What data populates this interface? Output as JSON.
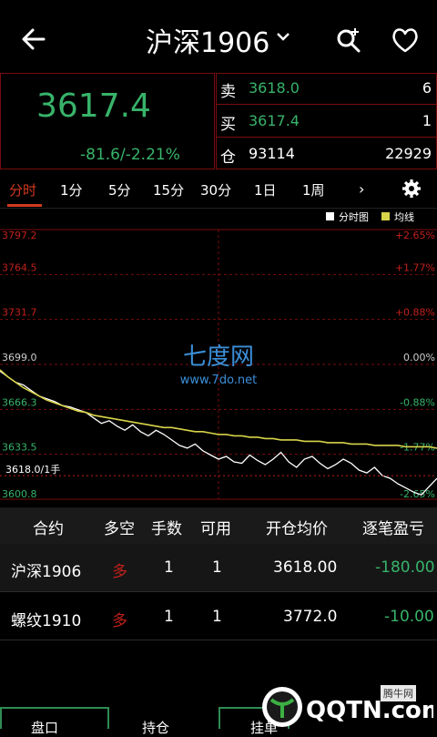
{
  "header": {
    "title": "沪深1906"
  },
  "quote": {
    "last_price": "3617.4",
    "change": "-81.6/-2.21%",
    "rows": [
      {
        "label": "卖",
        "value": "3618.0",
        "volume": "6"
      },
      {
        "label": "买",
        "value": "3617.4",
        "volume": "1"
      },
      {
        "label": "仓",
        "value": "93114",
        "volume": "22929"
      }
    ]
  },
  "tabs": [
    "分时",
    "1分",
    "5分",
    "15分",
    "30分",
    "1日",
    "1周"
  ],
  "tabs_more": "›",
  "chart_data": {
    "type": "line",
    "legend": [
      "分时图",
      "均线"
    ],
    "y_left_ticks": [
      "3797.2",
      "3764.5",
      "3731.7",
      "3699.0",
      "3666.3",
      "3633.5",
      "3600.8"
    ],
    "y_right_ticks": [
      "+2.65%",
      "+1.77%",
      "+0.88%",
      "0.00%",
      "-0.88%",
      "-1.77%",
      "-2.65%"
    ],
    "ylim": [
      3600.8,
      3797.2
    ],
    "annotation": "3618.0/1手",
    "series": [
      {
        "name": "分时图",
        "values": [
          3694,
          3690,
          3686,
          3684,
          3680,
          3676,
          3674,
          3672,
          3669,
          3668,
          3666,
          3664,
          3660,
          3656,
          3658,
          3654,
          3651,
          3655,
          3650,
          3647,
          3651,
          3648,
          3644,
          3640,
          3638,
          3641,
          3636,
          3633,
          3630,
          3632,
          3628,
          3627,
          3633,
          3629,
          3626,
          3630,
          3635,
          3628,
          3624,
          3630,
          3632,
          3627,
          3623,
          3626,
          3630,
          3627,
          3622,
          3620,
          3624,
          3618,
          3616,
          3612,
          3609,
          3606,
          3604,
          3610,
          3616
        ]
      },
      {
        "name": "均线",
        "values": [
          3695,
          3690,
          3686,
          3682,
          3679,
          3676,
          3673,
          3671,
          3669,
          3667,
          3665,
          3664,
          3662,
          3661,
          3660,
          3659,
          3658,
          3657,
          3656,
          3655,
          3654,
          3653,
          3653,
          3652,
          3651,
          3650,
          3650,
          3649,
          3648,
          3648,
          3647,
          3647,
          3646,
          3646,
          3645,
          3645,
          3644,
          3644,
          3644,
          3643,
          3643,
          3643,
          3642,
          3642,
          3642,
          3641,
          3641,
          3641,
          3640,
          3640,
          3640,
          3640,
          3639,
          3639,
          3639,
          3639,
          3638
        ]
      }
    ],
    "colors": {
      "price": "#ffffff",
      "avg": "#d8d44a",
      "grid": "#7a0c0c",
      "axis_red": "#c1201b",
      "axis_green": "#38b36a"
    }
  },
  "table": {
    "headers": [
      "合约",
      "多空",
      "手数",
      "可用",
      "开仓均价",
      "逐笔盈亏"
    ],
    "rows": [
      {
        "contract": "沪深1906",
        "direction": "多",
        "lots": "1",
        "available": "1",
        "avg_price": "3618.00",
        "pnl": "-180.00"
      },
      {
        "contract": "螺纹1910",
        "direction": "多",
        "lots": "1",
        "available": "1",
        "avg_price": "3772.0",
        "pnl": "-10.00"
      }
    ]
  },
  "bottom_tabs": [
    "盘口",
    "持仓",
    "挂单"
  ],
  "watermark": {
    "center": "七度网",
    "center_url": "www.7do.net",
    "corner_small": "腾牛网",
    "corner_brand": "QQTN.com"
  }
}
